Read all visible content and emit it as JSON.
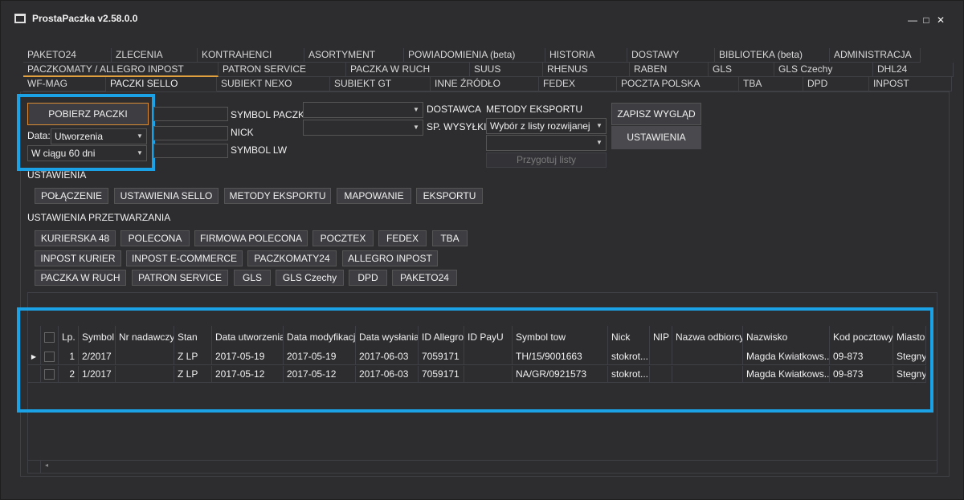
{
  "window": {
    "title": "ProstaPaczka v2.58.0.0",
    "minimize": "—",
    "maximize": "□",
    "close": "✕"
  },
  "tabs": {
    "row1": [
      "PAKETO24",
      "ZLECENIA",
      "KONTRAHENCI",
      "ASORTYMENT",
      "POWIADOMIENIA (beta)",
      "HISTORIA",
      "DOSTAWY",
      "BIBLIOTEKA (beta)",
      "ADMINISTRACJA"
    ],
    "row2": [
      "PACZKOMATY / ALLEGRO INPOST",
      "PATRON SERVICE",
      "PACZKA W RUCH",
      "SUUS",
      "RHENUS",
      "RABEN",
      "GLS",
      "GLS Czechy",
      "DHL24"
    ],
    "row3": [
      "WF-MAG",
      "PACZKI SELLO",
      "SUBIEKT NEXO",
      "SUBIEKT GT",
      "INNE ŹRÓDŁO",
      "FEDEX",
      "POCZTA POLSKA",
      "TBA",
      "DPD",
      "INPOST"
    ]
  },
  "fetch": {
    "button": "POBIERZ PACZKI",
    "data_label": "Data:",
    "data_value": "Utworzenia",
    "period_value": "W ciągu 60 dni"
  },
  "filters": {
    "symbol_paczki": "SYMBOL PACZKI",
    "nick": "NICK",
    "symbol_lw": "SYMBOL LW",
    "dostawca": "DOSTAWCA",
    "sp_wysylki": "SP. WYSYŁKI"
  },
  "export": {
    "label": "METODY EKSPORTU",
    "select_value": "Wybór z listy rozwijanej",
    "prepare": "Przygotuj listy"
  },
  "actions": {
    "save_view": "ZAPISZ WYGLĄD",
    "settings": "USTAWIENIA"
  },
  "settings": {
    "title": "USTAWIENIA",
    "buttons": [
      "POŁĄCZENIE",
      "USTAWIENIA SELLO",
      "METODY EKSPORTU",
      "MAPOWANIE",
      "EKSPORTU"
    ]
  },
  "processing": {
    "title": "USTAWIENIA PRZETWARZANIA",
    "row1": [
      "KURIERSKA 48",
      "POLECONA",
      "FIRMOWA POLECONA",
      "POCZTEX",
      "FEDEX",
      "TBA"
    ],
    "row2": [
      "INPOST KURIER",
      "INPOST E-COMMERCE",
      "PACZKOMATY24",
      "ALLEGRO INPOST"
    ],
    "row3": [
      "PACZKA W RUCH",
      "PATRON SERVICE",
      "GLS",
      "GLS Czechy",
      "DPD",
      "PAKETO24"
    ]
  },
  "grid": {
    "columns": [
      "Lp.",
      "Symbol",
      "Nr nadawczy",
      "Stan",
      "Data utworzenia",
      "Data modyfikacji",
      "Data wysłania",
      "ID Allegro",
      "ID PayU",
      "Symbol tow",
      "Nick",
      "NIP",
      "Nazwa odbiorcy",
      "Nazwisko",
      "Kod pocztowy",
      "Miasto"
    ],
    "rows": [
      [
        "1",
        "2/2017",
        "",
        "Z LP",
        "2017-05-19",
        "2017-05-19",
        "2017-06-03",
        "7059171",
        "",
        "TH/15/9001663",
        "stokrot...",
        "",
        "",
        "Magda Kwiatkows...",
        "09-873",
        "Stegny"
      ],
      [
        "2",
        "1/2017",
        "",
        "Z LP",
        "2017-05-12",
        "2017-05-12",
        "2017-06-03",
        "7059171",
        "",
        "NA/GR/0921573",
        "stokrot...",
        "",
        "",
        "Magda Kwiatkows...",
        "09-873",
        "Stegny"
      ]
    ]
  }
}
